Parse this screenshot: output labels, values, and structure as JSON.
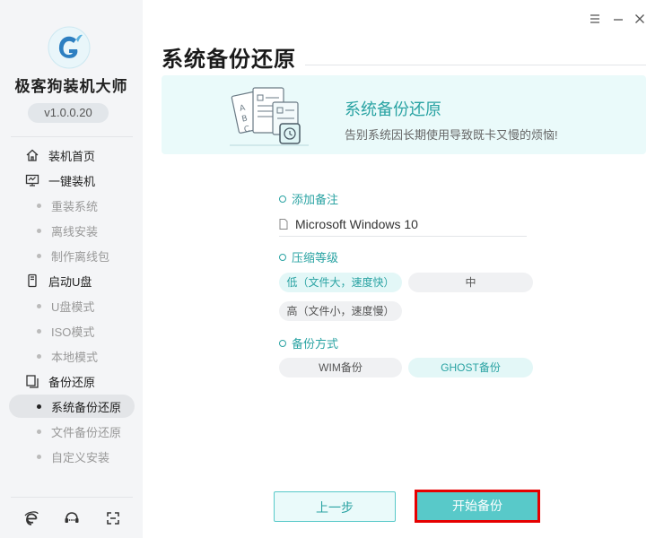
{
  "sidebar": {
    "app_name": "极客狗装机大师",
    "version": "v1.0.0.20",
    "sections": [
      {
        "label": "装机首页",
        "icon": "home-icon",
        "items": []
      },
      {
        "label": "一键装机",
        "icon": "monitor-icon",
        "items": [
          "重装系统",
          "离线安装",
          "制作离线包"
        ]
      },
      {
        "label": "启动U盘",
        "icon": "usb-icon",
        "items": [
          "U盘模式",
          "ISO模式",
          "本地模式"
        ]
      },
      {
        "label": "备份还原",
        "icon": "backup-icon",
        "items": [
          "系统备份还原",
          "文件备份还原",
          "自定义安装"
        ]
      }
    ],
    "active_item": "系统备份还原",
    "bottom_icons": [
      "browser-icon",
      "support-chat-icon",
      "fullscreen-icon"
    ]
  },
  "window_controls": [
    "menu-icon",
    "minimize-icon",
    "close-icon"
  ],
  "page_title": "系统备份还原",
  "banner": {
    "title": "系统备份还原",
    "subtitle": "告别系统因长期使用导致既卡又慢的烦恼!"
  },
  "form": {
    "note_label": "添加备注",
    "note_value": "Microsoft Windows 10",
    "compression_label": "压缩等级",
    "compression_options": [
      {
        "label": "低（文件大，速度快）",
        "selected": true
      },
      {
        "label": "中",
        "selected": false
      },
      {
        "label": "高（文件小，速度慢）",
        "selected": false
      }
    ],
    "method_label": "备份方式",
    "method_options": [
      {
        "label": "WIM备份",
        "selected": false
      },
      {
        "label": "GHOST备份",
        "selected": true
      }
    ]
  },
  "buttons": {
    "prev": "上一步",
    "start": "开始备份"
  },
  "colors": {
    "accent": "#2aa3a3",
    "button_fill": "#58c9c9",
    "highlight_border": "#e60000",
    "sidebar_bg": "#f4f5f7"
  }
}
